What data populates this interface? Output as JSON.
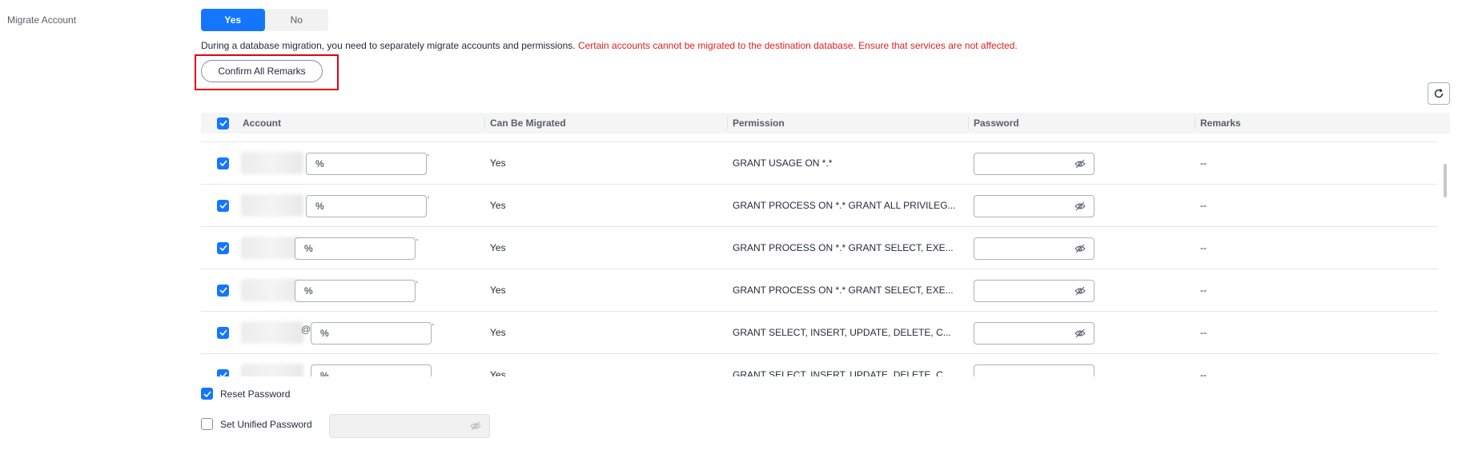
{
  "migrate_account": {
    "label": "Migrate Account",
    "options": [
      {
        "label": "Yes",
        "selected": true
      },
      {
        "label": "No",
        "selected": false
      }
    ]
  },
  "description": {
    "normal": "During a database migration, you need to separately migrate accounts and permissions.",
    "warning": "Certain accounts cannot be migrated to the destination database. Ensure that services are not affected."
  },
  "confirm_button": "Confirm All Remarks",
  "table": {
    "headers": [
      "Account",
      "Can Be Migrated",
      "Permission",
      "Password",
      "Remarks"
    ],
    "rows": [
      {
        "checked": true,
        "host": "%",
        "migratable": "Yes",
        "permission": "GRANT USAGE ON *.*",
        "remarks": "--"
      },
      {
        "checked": true,
        "host": "%",
        "migratable": "Yes",
        "permission": "GRANT PROCESS ON *.* GRANT ALL PRIVILEG...",
        "remarks": "--"
      },
      {
        "checked": true,
        "host": "%",
        "migratable": "Yes",
        "permission": "GRANT PROCESS ON *.* GRANT SELECT, EXE...",
        "remarks": "--"
      },
      {
        "checked": true,
        "host": "%",
        "migratable": "Yes",
        "permission": "GRANT PROCESS ON *.* GRANT SELECT, EXE...",
        "remarks": "--"
      },
      {
        "checked": true,
        "host": "%",
        "migratable": "Yes",
        "permission": "GRANT SELECT, INSERT, UPDATE, DELETE, C...",
        "remarks": "--"
      },
      {
        "checked": true,
        "host": "%",
        "migratable": "Yes",
        "permission": "GRANT SELECT, INSERT, UPDATE, DELETE, C...",
        "remarks": "--"
      }
    ]
  },
  "reset_password": {
    "label": "Reset Password",
    "checked": true
  },
  "unified_password": {
    "label": "Set Unified Password",
    "checked": false,
    "value": ""
  },
  "colors": {
    "primary": "#1476ff",
    "warning": "#e02020",
    "highlight": "#e50012"
  }
}
